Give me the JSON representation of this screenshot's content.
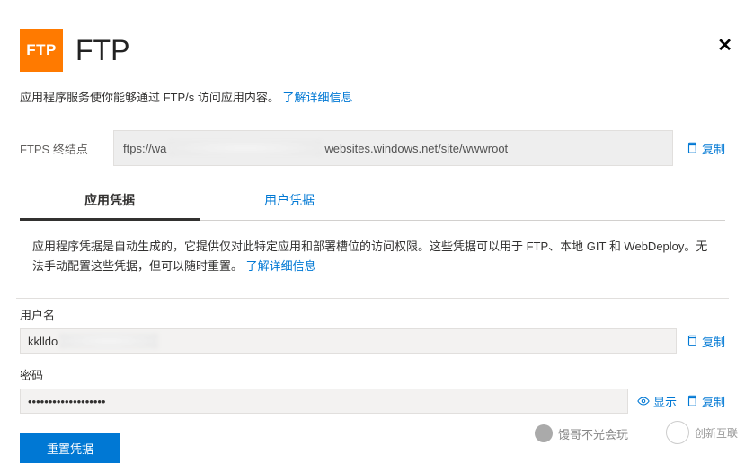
{
  "header": {
    "logo_text": "FTP",
    "title": "FTP"
  },
  "intro": {
    "text": "应用程序服务使你能够通过 FTP/s 访问应用内容。",
    "more_link": "了解详细信息"
  },
  "ftps": {
    "label": "FTPS 终结点",
    "value_prefix": "ftps://wa",
    "value_suffix": "websites.windows.net/site/wwwroot",
    "copy_label": "复制"
  },
  "tabs": {
    "app": "应用凭据",
    "user": "用户凭据"
  },
  "credential_intro": {
    "text": "应用程序凭据是自动生成的，它提供仅对此特定应用和部署槽位的访问权限。这些凭据可以用于 FTP、本地 GIT 和 WebDeploy。无法手动配置这些凭据，但可以随时重置。",
    "more_link": "了解详细信息"
  },
  "username": {
    "label": "用户名",
    "value_prefix": "kklldo",
    "copy_label": "复制"
  },
  "password": {
    "label": "密码",
    "masked": "•••••••••••••••••••",
    "show_label": "显示",
    "copy_label": "复制"
  },
  "reset_button": "重置凭据",
  "footer": {
    "wechat_text": "馒哥不光会玩",
    "brand": "创新互联"
  }
}
